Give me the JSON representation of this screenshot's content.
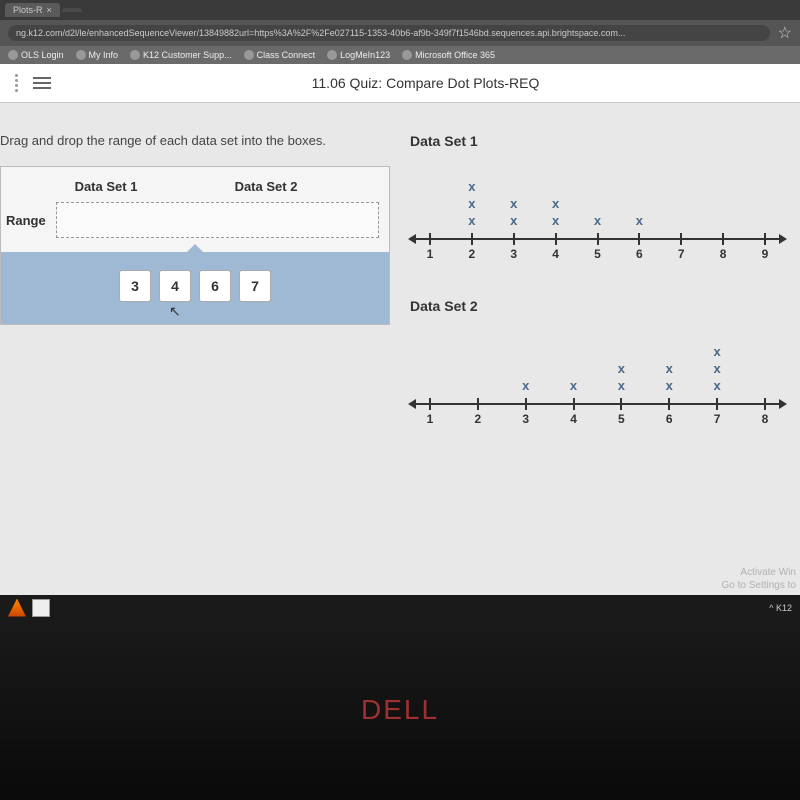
{
  "browser": {
    "tab_title": "Plots-R",
    "url": "ng.k12.com/d2l/le/enhancedSequenceViewer/13849882url=https%3A%2F%2Fe027115-1353-40b6-af9b-349f7f1546bd.sequences.api.brightspace.com...",
    "bookmarks": [
      {
        "label": "OLS Login"
      },
      {
        "label": "My Info"
      },
      {
        "label": "K12 Customer Supp..."
      },
      {
        "label": "Class Connect"
      },
      {
        "label": "LogMeIn123"
      },
      {
        "label": "Microsoft Office 365"
      }
    ]
  },
  "app": {
    "title": "11.06 Quiz: Compare Dot Plots-REQ"
  },
  "question": {
    "instruction": "Drag and drop the range of each data set into the boxes.",
    "columns": [
      "Data Set 1",
      "Data Set 2"
    ],
    "row_label": "Range",
    "tiles": [
      "3",
      "4",
      "6",
      "7"
    ]
  },
  "plots": {
    "set1_title": "Data Set 1",
    "set2_title": "Data Set 2"
  },
  "watermark": {
    "line1": "Activate Win",
    "line2": "Go to Settings to"
  },
  "tray": {
    "text": "K12"
  },
  "logo": "DELL",
  "chart_data": [
    {
      "type": "dot_plot",
      "title": "Data Set 1",
      "x_ticks": [
        1,
        2,
        3,
        4,
        5,
        6,
        7,
        8,
        9
      ],
      "counts": {
        "1": 0,
        "2": 3,
        "3": 2,
        "4": 2,
        "5": 1,
        "6": 1,
        "7": 0,
        "8": 0,
        "9": 0
      }
    },
    {
      "type": "dot_plot",
      "title": "Data Set 2",
      "x_ticks": [
        1,
        2,
        3,
        4,
        5,
        6,
        7,
        8
      ],
      "counts": {
        "1": 0,
        "2": 0,
        "3": 1,
        "4": 1,
        "5": 2,
        "6": 2,
        "7": 3,
        "8": 0
      }
    }
  ]
}
